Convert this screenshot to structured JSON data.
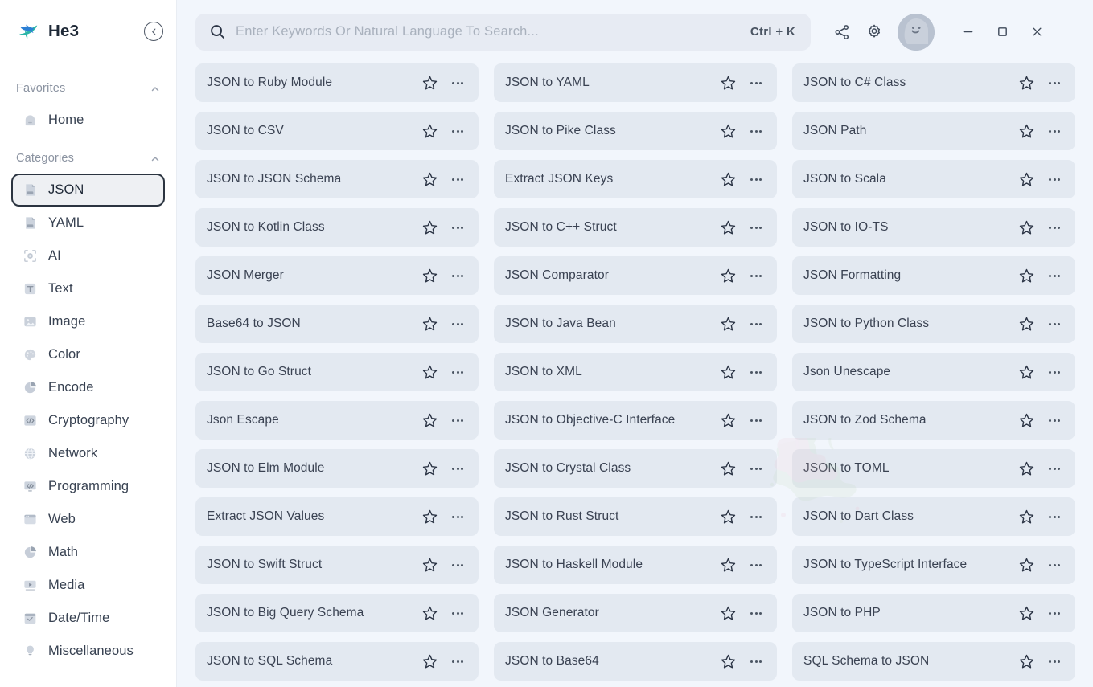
{
  "app": {
    "brand": "He3",
    "logo_icon": "he3-swoosh-logo",
    "collapse_icon": "chevron-left-circle-icon"
  },
  "search": {
    "placeholder": "Enter Keywords Or Natural Language To Search...",
    "shortcut": "Ctrl + K",
    "icon": "search-icon"
  },
  "topbar": {
    "share_icon": "share-icon",
    "settings_icon": "gear-icon",
    "avatar_icon": "user-avatar-smiley",
    "minimize_label": "—",
    "maximize_label": "☐",
    "close_label": "✕"
  },
  "sidebar": {
    "sections": [
      {
        "title": "Favorites",
        "collapse_icon": "chevron-up-icon"
      },
      {
        "title": "Categories",
        "collapse_icon": "chevron-up-icon"
      }
    ],
    "favorites": [
      {
        "label": "Home",
        "icon": "home-icon",
        "selected": false
      }
    ],
    "categories": [
      {
        "label": "JSON",
        "icon": "json-file-icon",
        "selected": true
      },
      {
        "label": "YAML",
        "icon": "yaml-file-icon",
        "selected": false
      },
      {
        "label": "AI",
        "icon": "ai-chip-icon",
        "selected": false
      },
      {
        "label": "Text",
        "icon": "text-icon",
        "selected": false
      },
      {
        "label": "Image",
        "icon": "image-icon",
        "selected": false
      },
      {
        "label": "Color",
        "icon": "color-palette-icon",
        "selected": false
      },
      {
        "label": "Encode",
        "icon": "encode-pie-icon",
        "selected": false
      },
      {
        "label": "Cryptography",
        "icon": "code-lock-icon",
        "selected": false
      },
      {
        "label": "Network",
        "icon": "globe-icon",
        "selected": false
      },
      {
        "label": "Programming",
        "icon": "monitor-code-icon",
        "selected": false
      },
      {
        "label": "Web",
        "icon": "browser-window-icon",
        "selected": false
      },
      {
        "label": "Math",
        "icon": "math-pie-icon",
        "selected": false
      },
      {
        "label": "Media",
        "icon": "media-play-icon",
        "selected": false
      },
      {
        "label": "Date/Time",
        "icon": "calendar-icon",
        "selected": false
      },
      {
        "label": "Miscellaneous",
        "icon": "lightbulb-icon",
        "selected": false
      }
    ]
  },
  "tools": [
    "JSON to Ruby Module",
    "JSON to YAML",
    "JSON to C# Class",
    "JSON to CSV",
    "JSON to Pike Class",
    "JSON Path",
    "JSON to JSON Schema",
    "Extract JSON Keys",
    "JSON to Scala",
    "JSON to Kotlin Class",
    "JSON to C++ Struct",
    "JSON to IO-TS",
    "JSON Merger",
    "JSON Comparator",
    "JSON Formatting",
    "Base64 to JSON",
    "JSON to Java Bean",
    "JSON to Python Class",
    "JSON to Go Struct",
    "JSON to XML",
    "Json Unescape",
    "Json Escape",
    "JSON to Objective-C Interface",
    "JSON to Zod Schema",
    "JSON to Elm Module",
    "JSON to Crystal Class",
    "JSON to TOML",
    "Extract JSON Values",
    "JSON to Rust Struct",
    "JSON to Dart Class",
    "JSON to Swift Struct",
    "JSON to Haskell Module",
    "JSON to TypeScript Interface",
    "JSON to Big Query Schema",
    "JSON Generator",
    "JSON to PHP",
    "JSON to SQL Schema",
    "JSON to Base64",
    "SQL Schema to JSON"
  ],
  "card_icons": {
    "favorite": "star-outline-icon",
    "more": "ellipsis-icon"
  },
  "colors": {
    "page_bg": "#f2f6fc",
    "sidebar_bg": "#ffffff",
    "card_bg": "#e3e9f1",
    "search_bg": "#e7ebf3",
    "text": "#3a4252",
    "muted": "#8b93a1",
    "selected_border": "#2b3440",
    "brand_blue": "#2b7fd4",
    "brand_teal": "#2bb5a8"
  }
}
